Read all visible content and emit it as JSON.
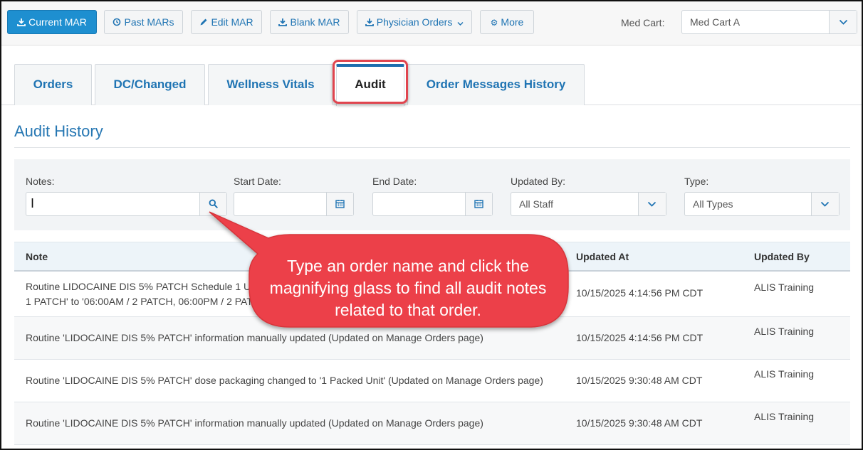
{
  "toolbar": {
    "current_mar": "Current MAR",
    "past_mars": "Past MARs",
    "edit_mar": "Edit MAR",
    "blank_mar": "Blank MAR",
    "physician_orders": "Physician Orders",
    "more": "More",
    "med_cart_label": "Med Cart:",
    "med_cart_value": "Med Cart A"
  },
  "tabs": [
    {
      "label": "Orders"
    },
    {
      "label": "DC/Changed"
    },
    {
      "label": "Wellness Vitals"
    },
    {
      "label": "Audit"
    },
    {
      "label": "Order Messages History"
    }
  ],
  "active_tab": "Audit",
  "section_title": "Audit History",
  "filters": {
    "notes_label": "Notes:",
    "notes_value": "",
    "start_date_label": "Start Date:",
    "end_date_label": "End Date:",
    "updated_by_label": "Updated By:",
    "updated_by_value": "All Staff",
    "type_label": "Type:",
    "type_value": "All Types"
  },
  "table": {
    "headers": [
      "Note",
      "Updated At",
      "Updated By"
    ],
    "rows": [
      {
        "note": "Routine LIDOCAINE DIS 5% PATCH Schedule 1 U",
        "note_line2": "1 PATCH' to '06:00AM / 2 PATCH, 06:00PM / 2 PAT",
        "updated_at": "10/15/2025 4:14:56 PM CDT",
        "updated_by": "ALIS Training"
      },
      {
        "note": "Routine 'LIDOCAINE DIS 5% PATCH' information manually updated (Updated on Manage Orders page)",
        "updated_at": "10/15/2025 4:14:56 PM CDT",
        "updated_by": "ALIS Training"
      },
      {
        "note": "Routine 'LIDOCAINE DIS 5% PATCH' dose packaging changed to '1 Packed Unit' (Updated on Manage Orders page)",
        "updated_at": "10/15/2025 9:30:48 AM CDT",
        "updated_by": "ALIS Training"
      },
      {
        "note": "Routine 'LIDOCAINE DIS 5% PATCH' information manually updated (Updated on Manage Orders page)",
        "updated_at": "10/15/2025 9:30:48 AM CDT",
        "updated_by": "ALIS Training"
      }
    ]
  },
  "callout": {
    "text": "Type an order name and click the magnifying glass to find all audit notes related to that order."
  },
  "colors": {
    "primary": "#1e8fd0",
    "link": "#1f74b3",
    "active_tab_border": "#1e6eae",
    "callout": "#ec4148",
    "highlight": "#e0454f"
  }
}
